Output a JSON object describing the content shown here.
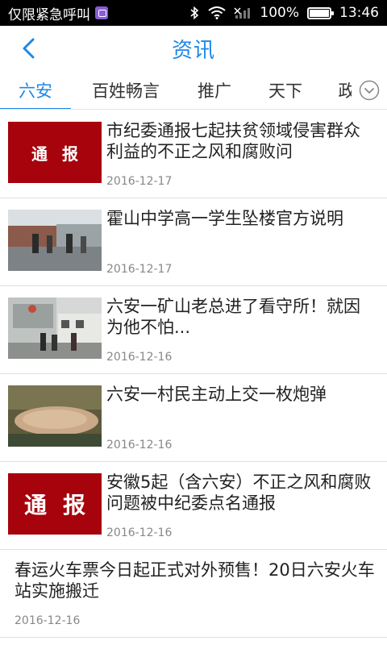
{
  "status_bar": {
    "carrier": "仅限紧急呼叫",
    "battery": "100%",
    "battery_level": 1.0,
    "time": "13:46",
    "icons": [
      "app-badge-icon",
      "bluetooth-icon",
      "wifi-icon",
      "no-signal-icon",
      "battery-icon"
    ]
  },
  "header": {
    "title": "资讯",
    "back_icon": "chevron-left-icon",
    "accent_color": "#1e87e6"
  },
  "tabs": [
    {
      "label": "六安",
      "active": true
    },
    {
      "label": "百姓畅言",
      "active": false
    },
    {
      "label": "推广",
      "active": false
    },
    {
      "label": "天下",
      "active": false
    },
    {
      "label": "政",
      "active": false
    }
  ],
  "tabs_more_icon": "chevron-down-circle-icon",
  "news": [
    {
      "headline": "市纪委通报七起扶贫领域侵害群众利益的不正之风和腐败问",
      "date": "2016-12-17",
      "thumb_text": "通报"
    },
    {
      "headline": "霍山中学高一学生坠楼官方说明",
      "date": "2016-12-17"
    },
    {
      "headline": "六安一矿山老总进了看守所！就因为他不怕...",
      "date": "2016-12-16"
    },
    {
      "headline": "六安一村民主动上交一枚炮弹",
      "date": "2016-12-16"
    },
    {
      "headline": "安徽5起（含六安）不正之风和腐败问题被中纪委点名通报",
      "date": "2016-12-16",
      "thumb_text": "通报"
    },
    {
      "headline": "春运火车票今日起正式对外预售！20日六安火车站实施搬迁",
      "date": "2016-12-16"
    }
  ]
}
